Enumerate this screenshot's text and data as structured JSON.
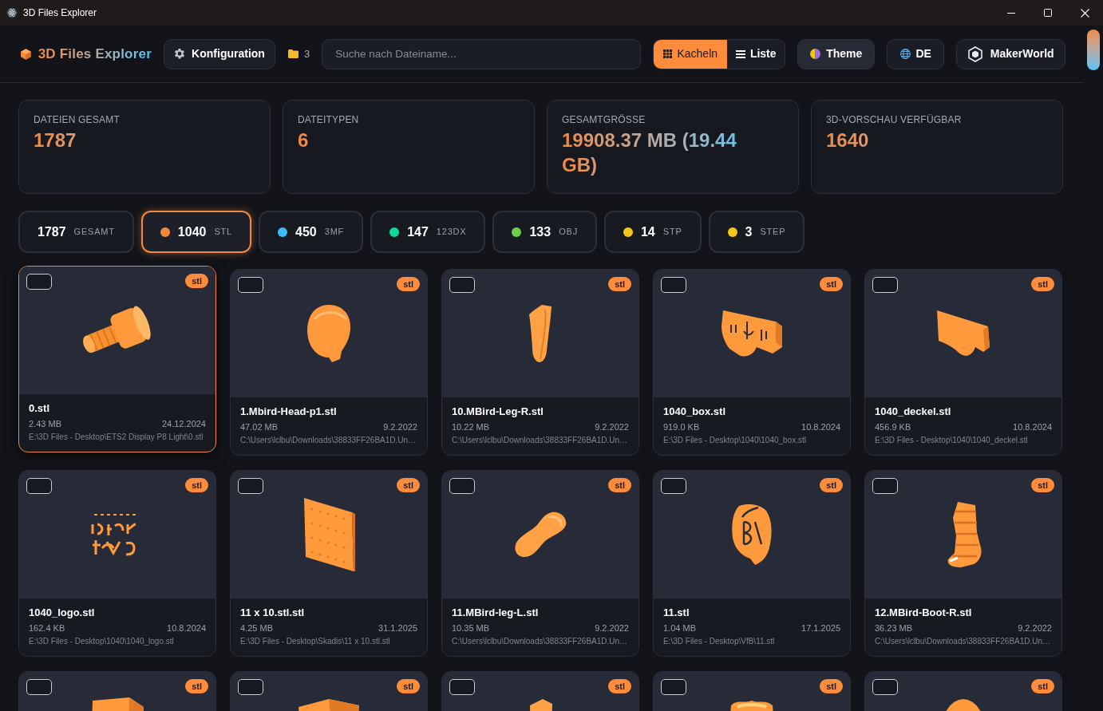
{
  "window": {
    "title": "3D Files Explorer"
  },
  "header": {
    "app_name": "3D Files Explorer",
    "config_button": "Konfiguration",
    "folder_count": "3",
    "search": {
      "placeholder": "Suche nach Dateiname..."
    },
    "view_toggle": [
      {
        "label": "Kacheln",
        "selected": true
      },
      {
        "label": "Liste",
        "selected": false
      }
    ],
    "theme_button": "Theme",
    "language_button": "DE",
    "makerworld_button": "MakerWorld"
  },
  "stats": [
    {
      "label": "DATEIEN GESAMT",
      "value": "1787"
    },
    {
      "label": "DATEITYPEN",
      "value": "6"
    },
    {
      "label": "GESAMTGRÖSSE",
      "value": "19908.37 MB (19.44 GB)"
    },
    {
      "label": "3D-VORSCHAU VERFÜGBAR",
      "value": "1640"
    }
  ],
  "filters": [
    {
      "count": "1787",
      "label": "GESAMT",
      "selected": false
    },
    {
      "count": "1040",
      "label": "STL",
      "selected": true,
      "color": "#f0883e"
    },
    {
      "count": "450",
      "label": "3MF",
      "selected": false,
      "color": "#38bdf8"
    },
    {
      "count": "147",
      "label": "123DX",
      "selected": false,
      "color": "#10d9a0"
    },
    {
      "count": "133",
      "label": "OBJ",
      "selected": false,
      "color": "#6cd04a"
    },
    {
      "count": "14",
      "label": "STP",
      "selected": false,
      "color": "#f5c518"
    },
    {
      "count": "3",
      "label": "STEP",
      "selected": false,
      "color": "#f5c518"
    }
  ],
  "files": [
    {
      "name": "0.stl",
      "size": "2.43 MB",
      "date": "24.12.2024",
      "path": "E:\\3D Files - Desktop\\ETS2 Display P8 Light\\0.stl",
      "badge": "stl",
      "checked": false,
      "selected": true
    },
    {
      "name": "1.Mbird-Head-p1.stl",
      "size": "47.02 MB",
      "date": "9.2.2022",
      "path": "C:\\Users\\lclbu\\Downloads\\38833FF26BA1D.Un…",
      "badge": "stl",
      "checked": false,
      "selected": false
    },
    {
      "name": "10.MBird-Leg-R.stl",
      "size": "10.22 MB",
      "date": "9.2.2022",
      "path": "C:\\Users\\lclbu\\Downloads\\38833FF26BA1D.Un…",
      "badge": "stl",
      "checked": false,
      "selected": false
    },
    {
      "name": "1040_box.stl",
      "size": "919.0 KB",
      "date": "10.8.2024",
      "path": "E:\\3D Files - Desktop\\1040\\1040_box.stl",
      "badge": "stl",
      "checked": false,
      "selected": false
    },
    {
      "name": "1040_deckel.stl",
      "size": "456.9 KB",
      "date": "10.8.2024",
      "path": "E:\\3D Files - Desktop\\1040\\1040_deckel.stl",
      "badge": "stl",
      "checked": false,
      "selected": false
    },
    {
      "name": "1040_logo.stl",
      "size": "162.4 KB",
      "date": "10.8.2024",
      "path": "E:\\3D Files - Desktop\\1040\\1040_logo.stl",
      "badge": "stl",
      "checked": false,
      "selected": false
    },
    {
      "name": "11 x 10.stl.stl",
      "size": "4.25 MB",
      "date": "31.1.2025",
      "path": "E:\\3D Files - Desktop\\Skadis\\11 x 10.stl.stl",
      "badge": "stl",
      "checked": false,
      "selected": false
    },
    {
      "name": "11.MBird-leg-L.stl",
      "size": "10.35 MB",
      "date": "9.2.2022",
      "path": "C:\\Users\\lclbu\\Downloads\\38833FF26BA1D.Un…",
      "badge": "stl",
      "checked": false,
      "selected": false
    },
    {
      "name": "11.stl",
      "size": "1.04 MB",
      "date": "17.1.2025",
      "path": "E:\\3D Files - Desktop\\VfB\\11.stl",
      "badge": "stl",
      "checked": false,
      "selected": false
    },
    {
      "name": "12.MBird-Boot-R.stl",
      "size": "36.23 MB",
      "date": "9.2.2022",
      "path": "C:\\Users\\lclbu\\Downloads\\38833FF26BA1D.Un…",
      "badge": "stl",
      "checked": false,
      "selected": false
    },
    {
      "badge": "stl",
      "checked": false,
      "selected": false
    },
    {
      "badge": "stl",
      "checked": false,
      "selected": false
    },
    {
      "badge": "stl",
      "checked": false,
      "selected": false
    },
    {
      "badge": "stl",
      "checked": false,
      "selected": false
    },
    {
      "badge": "stl",
      "checked": false,
      "selected": false
    }
  ]
}
